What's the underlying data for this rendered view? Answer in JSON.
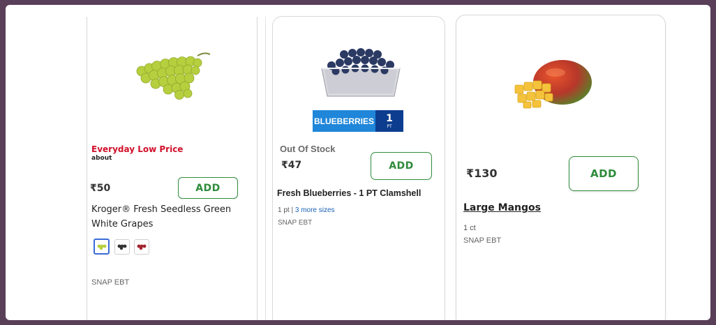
{
  "products": [
    {
      "promo_label": "Everyday Low Price",
      "promo_sub": "about",
      "price": "₹50",
      "add_label": "ADD",
      "name": "Kroger® Fresh Seedless Green White Grapes",
      "variants": [
        "green-grapes-thumb",
        "black-grapes-thumb",
        "red-grapes-thumb"
      ],
      "snap": "SNAP EBT",
      "image": "green-grapes-image"
    },
    {
      "badge_text": "BLUEBERRIES",
      "badge_qty": "1",
      "badge_unit": "PT",
      "status": "Out Of Stock",
      "price": "₹47",
      "add_label": "ADD",
      "name": "Fresh Blueberries - 1 PT Clamshell",
      "size": "1 pt",
      "size_sep": "|",
      "more_sizes": "3 more sizes",
      "snap": "SNAP EBT",
      "image": "blueberries-clamshell-image"
    },
    {
      "price": "₹130",
      "add_label": "ADD",
      "name": "Large Mangos",
      "size": "1 ct",
      "snap": "SNAP EBT",
      "image": "mango-image"
    }
  ],
  "colors": {
    "promo_red": "#d0102a",
    "add_green": "#2e8b3a",
    "link_blue": "#1a5fb4",
    "badge_blue": "#1f86d9",
    "badge_navy": "#0c3d8f"
  }
}
